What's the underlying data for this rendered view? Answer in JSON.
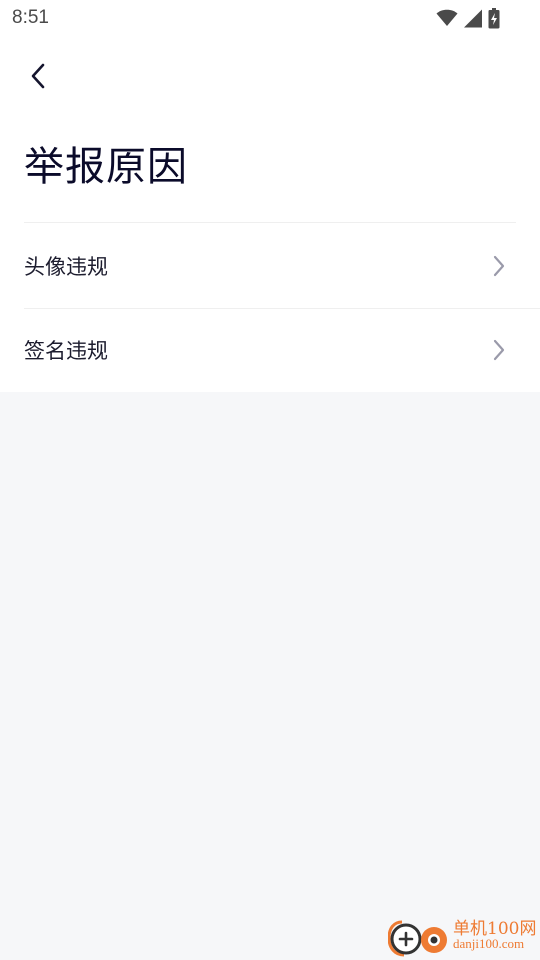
{
  "status_bar": {
    "time": "8:51",
    "icons": [
      "wifi-icon",
      "cellular-signal-icon",
      "battery-charging-icon"
    ]
  },
  "header": {
    "back_icon": "chevron-left-icon",
    "title": "举报原因"
  },
  "report_reasons": [
    {
      "label": "头像违规",
      "icon": "chevron-right-icon"
    },
    {
      "label": "签名违规",
      "icon": "chevron-right-icon"
    }
  ],
  "watermark": {
    "name": "单机100网",
    "url": "danji100.com"
  },
  "colors": {
    "page_background": "#f6f7f9",
    "card_background": "#ffffff",
    "title_text": "#0b0b2a",
    "chevron": "#9a9aaa",
    "watermark": "#ee7b33"
  }
}
